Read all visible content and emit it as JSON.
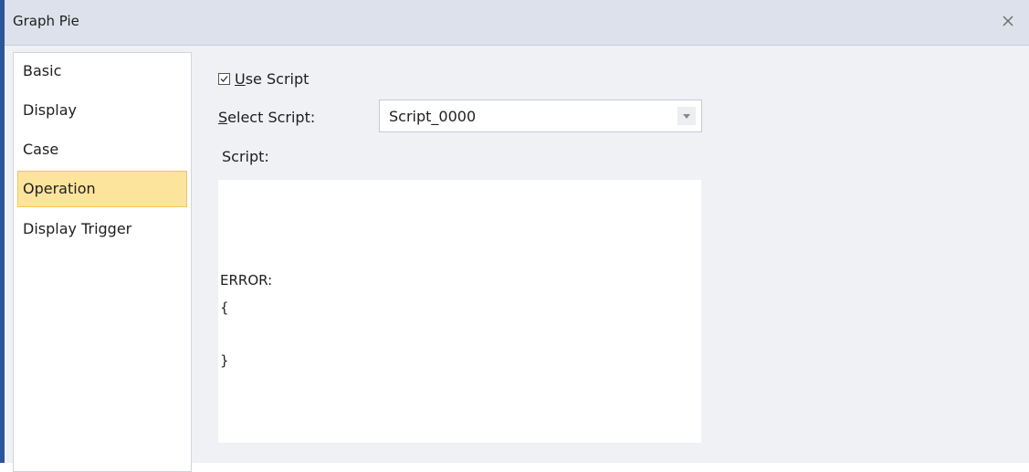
{
  "window": {
    "title": "Graph Pie",
    "close_glyph": "✕",
    "close_icon": "close-icon"
  },
  "sidebar": {
    "items": [
      {
        "label": "Basic",
        "active": false
      },
      {
        "label": "Display",
        "active": false
      },
      {
        "label": "Case",
        "active": false
      },
      {
        "label": "Operation",
        "active": true
      },
      {
        "label": "Display Trigger",
        "active": false
      }
    ]
  },
  "operation": {
    "use_script": {
      "checked": true,
      "mnemonic": "U",
      "label_rest": "se Script"
    },
    "select_script": {
      "mnemonic": "S",
      "label_rest": "elect Script:",
      "value": "Script_0000",
      "arrow_icon": "dropdown-arrow-icon"
    },
    "script_label": "Script:",
    "script_lines": [
      "ERROR:",
      "{",
      "}"
    ]
  },
  "colors": {
    "accent_border": "#2b579a",
    "active_item_bg": "#fde49c",
    "active_item_border": "#f5c65a",
    "dialog_bg": "#f0f1f5",
    "titlebar_bg": "#dde1eb"
  }
}
